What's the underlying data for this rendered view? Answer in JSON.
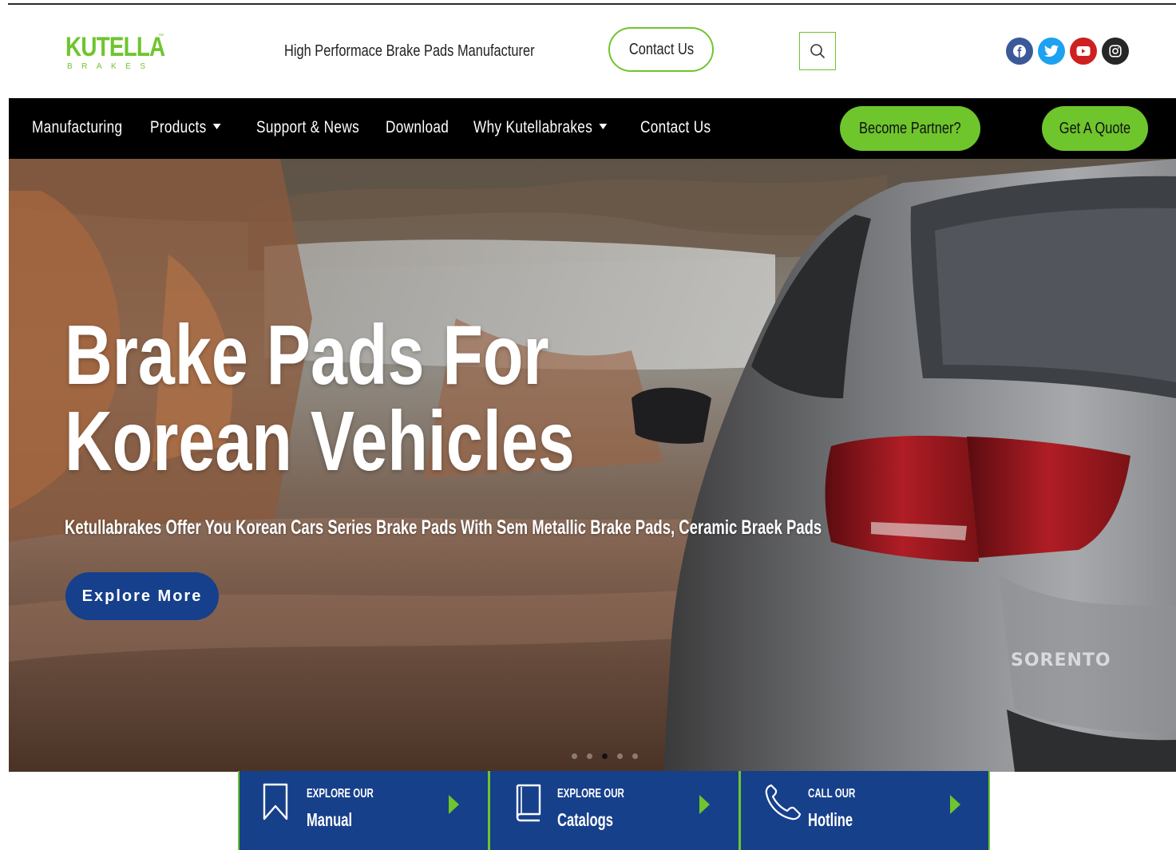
{
  "brand": {
    "logo_main": "KUTELLA",
    "logo_tm": "™",
    "logo_sub": "BRAKES",
    "tagline": "High Performace Brake Pads Manufacturer",
    "green": "#6fc52c",
    "blue": "#17408b"
  },
  "header": {
    "contact_label": "Contact Us",
    "search_icon": "search-icon",
    "socials": [
      {
        "icon": "facebook-icon",
        "color": "#3b5998"
      },
      {
        "icon": "twitter-icon",
        "color": "#1da1f2"
      },
      {
        "icon": "youtube-icon",
        "color": "#cd201f"
      },
      {
        "icon": "instagram-icon",
        "color": "#262626"
      }
    ]
  },
  "nav": {
    "items": [
      {
        "label": "Manufacturing",
        "dropdown": false
      },
      {
        "label": "Products",
        "dropdown": true
      },
      {
        "label": "Support & News",
        "dropdown": false
      },
      {
        "label": "Download",
        "dropdown": false
      },
      {
        "label": "Why Kutellabrakes",
        "dropdown": true
      },
      {
        "label": "Contact Us",
        "dropdown": false
      }
    ],
    "partner_label": "Become Partner?",
    "quote_label": "Get A Quote"
  },
  "hero": {
    "title": "Brake Pads For Korean Vehicles",
    "subtitle": "Ketullabrakes Offer You Korean Cars Series Brake Pads With Sem Metallic Brake Pads, Ceramic Braek Pads",
    "button_label": "Explore More",
    "slides_total": 5,
    "slide_active": 2,
    "car_badge": "SORENTO"
  },
  "cards": [
    {
      "small": "EXPLORE OUR",
      "big": "Manual",
      "icon": "bookmark-icon"
    },
    {
      "small": "EXPLORE OUR",
      "big": "Catalogs",
      "icon": "book-icon"
    },
    {
      "small": "CALL OUR",
      "big": "Hotline",
      "icon": "phone-icon"
    }
  ]
}
